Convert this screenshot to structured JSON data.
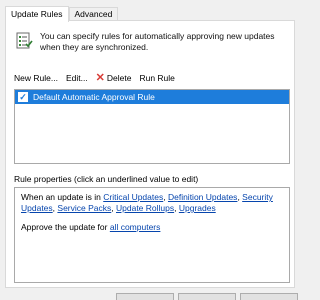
{
  "tabs": [
    {
      "label": "Update Rules",
      "active": true
    },
    {
      "label": "Advanced",
      "active": false
    }
  ],
  "info": {
    "icon": "rules-document-icon",
    "text": "You can specify rules for automatically approving new updates when they are synchronized."
  },
  "toolbar": {
    "new_rule": "New Rule...",
    "edit": "Edit...",
    "delete": "Delete",
    "run_rule": "Run Rule"
  },
  "rules": [
    {
      "label": "Default Automatic Approval Rule",
      "checked": true,
      "selected": true
    }
  ],
  "properties": {
    "label": "Rule properties (click an underlined value to edit)",
    "line1_prefix": "When an update is in ",
    "classifications": [
      "Critical Updates",
      "Definition Updates",
      "Security Updates",
      "Service Packs",
      "Update Rollups",
      "Upgrades"
    ],
    "line2_prefix": "Approve the update for ",
    "computers": "all computers"
  },
  "colors": {
    "selection": "#1e7ddb",
    "link": "#0645ad",
    "delete_icon": "#d83b36"
  }
}
